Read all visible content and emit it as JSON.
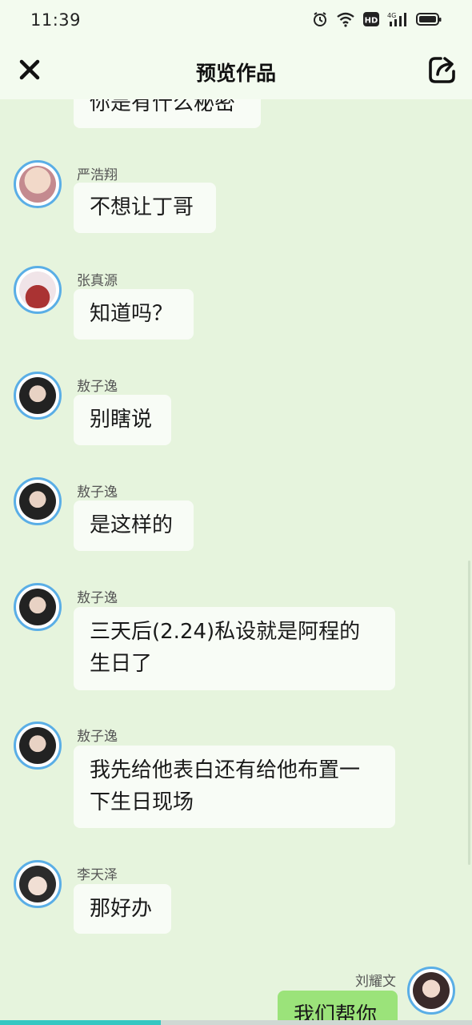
{
  "status_bar": {
    "time": "11:39",
    "icons": [
      "alarm-icon",
      "wifi-icon",
      "hd-icon",
      "signal-4g-icon",
      "battery-icon"
    ],
    "network_label": "4G",
    "hd_label": "HD"
  },
  "header": {
    "title": "预览作品",
    "close_icon": "close-icon",
    "share_icon": "share-icon"
  },
  "messages": [
    {
      "sender": "",
      "text": "你是有什么秘密",
      "side": "left"
    },
    {
      "sender": "严浩翔",
      "text": "不想让丁哥",
      "side": "left"
    },
    {
      "sender": "张真源",
      "text": "知道吗？",
      "side": "left"
    },
    {
      "sender": "敖子逸",
      "text": "别瞎说",
      "side": "left"
    },
    {
      "sender": "敖子逸",
      "text": "是这样的",
      "side": "left"
    },
    {
      "sender": "敖子逸",
      "text": "三天后(2.24)私设就是阿程的生日了",
      "side": "left"
    },
    {
      "sender": "敖子逸",
      "text": "我先给他表白还有给他布置一下生日现场",
      "side": "left"
    },
    {
      "sender": "李天泽",
      "text": "那好办",
      "side": "left"
    },
    {
      "sender": "刘耀文",
      "text": "我们帮你",
      "side": "right"
    }
  ],
  "progress": {
    "fraction": 0.34
  },
  "colors": {
    "background": "#e6f4dd",
    "bubble_left": "#f8fcf6",
    "bubble_right": "#9be37a",
    "avatar_border": "#5aaee6",
    "accent": "#35c7c2"
  }
}
